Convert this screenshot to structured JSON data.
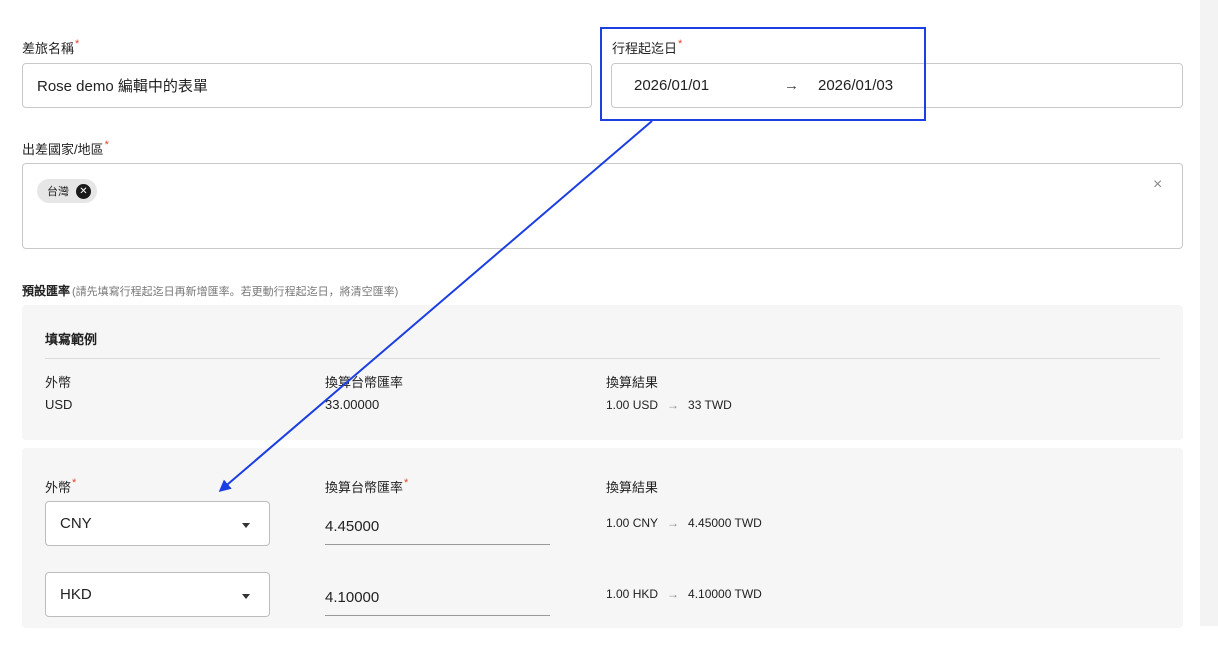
{
  "trip_name": {
    "label": "差旅名稱",
    "required_mark": "*",
    "value": "Rose demo 編輯中的表單"
  },
  "date_range": {
    "label": "行程起迄日",
    "required_mark": "*",
    "start": "2026/01/01",
    "arrow": "→",
    "end": "2026/01/03"
  },
  "country": {
    "label": "出差國家/地區",
    "required_mark": "*",
    "chips": [
      "台灣"
    ],
    "chip_remove_glyph": "✕",
    "clear_glyph": "×"
  },
  "rates": {
    "title": "預設匯率",
    "hint": "(請先填寫行程起迄日再新增匯率。若更動行程起迄日，將清空匯率)",
    "example": {
      "title": "填寫範例",
      "col_currency": "外幣",
      "col_rate": "換算台幣匯率",
      "col_result": "換算結果",
      "currency": "USD",
      "rate": "33.00000",
      "result_from": "1.00 USD",
      "arrow": "→",
      "result_to": "33 TWD"
    },
    "entry": {
      "col_currency": "外幣",
      "col_rate": "換算台幣匯率",
      "col_result": "換算結果",
      "required_mark": "*",
      "arrow": "→",
      "rows": [
        {
          "currency": "CNY",
          "rate": "4.45000",
          "result_from": "1.00 CNY",
          "result_to": "4.45000 TWD"
        },
        {
          "currency": "HKD",
          "rate": "4.10000",
          "result_from": "1.00 HKD",
          "result_to": "4.10000 TWD"
        }
      ]
    }
  },
  "colors": {
    "highlight": "#1b3fe0",
    "required": "#e5432d",
    "panel": "#f6f6f6"
  }
}
